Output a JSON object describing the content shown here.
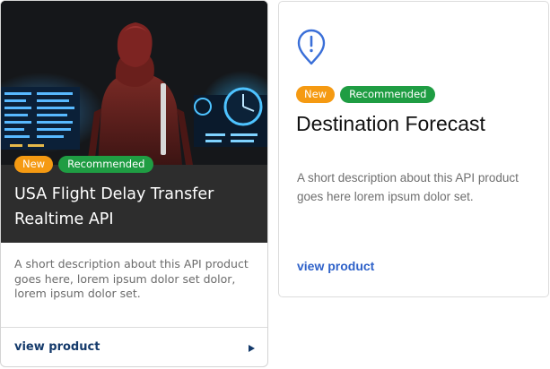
{
  "cards": [
    {
      "badges": {
        "new": "New",
        "recommended": "Recommended"
      },
      "title": "USA Flight Delay Transfer Realtime API",
      "description": "A short description about this API product goes here, lorem ipsum dolor set dolor,  lorem ipsum dolor set.",
      "link_label": "view product",
      "hero_image": "traveler-at-airport-departures-board",
      "link_icon": "play-arrow-icon"
    },
    {
      "icon": "map-pin-alert-icon",
      "badges": {
        "new": "New",
        "recommended": "Recommended"
      },
      "title": "Destination Forecast",
      "description": "A short description about this API product goes here lorem ipsum dolor set.",
      "link_label": "view product"
    }
  ],
  "colors": {
    "new_badge": "#f59a12",
    "recommended_badge": "#1f9d43",
    "card1_link": "#143a6b",
    "card2_link": "#2f62c9",
    "card2_icon": "#3a6fd8",
    "hero_overlay": "#2d2d2d"
  }
}
